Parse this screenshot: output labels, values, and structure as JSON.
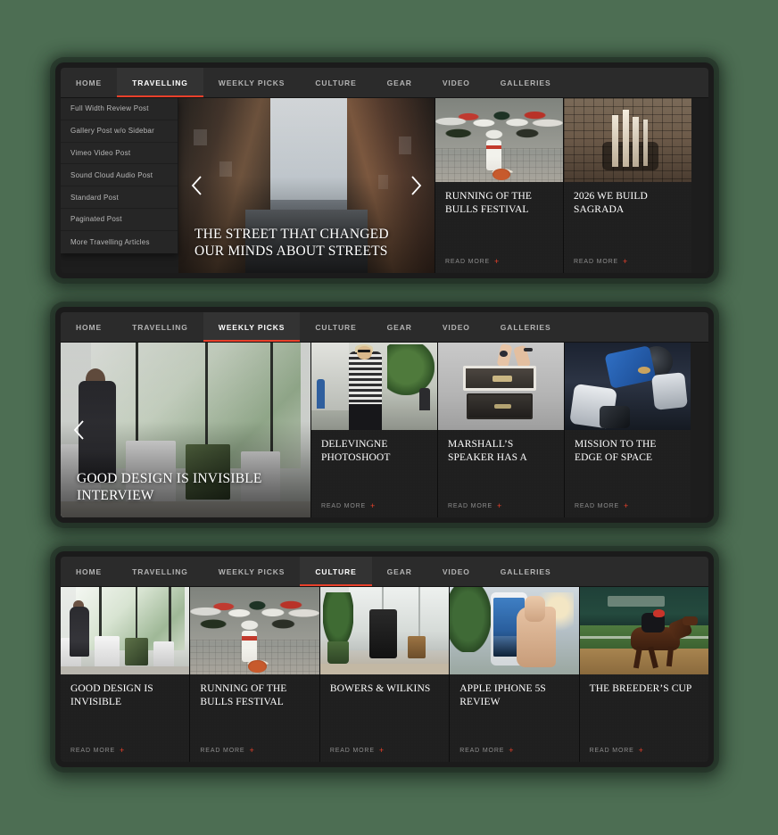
{
  "background_color": "#4d6e53",
  "accent_color": "#e8402a",
  "nav": {
    "items": [
      "HOME",
      "TRAVELLING",
      "WEEKLY PICKS",
      "CULTURE",
      "GEAR",
      "VIDEO",
      "GALLERIES"
    ]
  },
  "panels": [
    {
      "id": "panel-travelling",
      "active_tab": "TRAVELLING",
      "active_index": 1,
      "dropdown": {
        "visible": true,
        "items": [
          "Full Width Review Post",
          "Gallery Post w/o Sidebar",
          "Vimeo Video Post",
          "Sound Cloud Audio Post",
          "Standard Post",
          "Paginated Post",
          "More Travelling Articles"
        ]
      },
      "hero": {
        "title": "THE STREET THAT CHANGED OUR MINDS ABOUT STREETS",
        "photo": "street-canyon-photo",
        "prev_icon": "chevron-left-icon",
        "next_icon": "chevron-right-icon"
      },
      "cards": [
        {
          "title": "RUNNING OF THE BULLS FESTIVAL",
          "read_more": "READ MORE",
          "photo": "bull-run-crowd-photo"
        },
        {
          "title": "2026 WE BUILD SAGRADA",
          "read_more": "READ MORE",
          "photo": "sagrada-familia-aerial-photo"
        }
      ]
    },
    {
      "id": "panel-weekly-picks",
      "active_tab": "WEEKLY PICKS",
      "active_index": 2,
      "dropdown": {
        "visible": false,
        "items": []
      },
      "hero": {
        "title": "GOOD DESIGN IS INVISIBLE INTERVIEW",
        "photo": "office-imac-workspace-photo",
        "prev_icon": "chevron-left-icon",
        "next_icon": "chevron-right-icon"
      },
      "cards": [
        {
          "title": "DELEVINGNE PHOTOSHOOT",
          "read_more": "READ MORE",
          "photo": "street-style-fashion-photo"
        },
        {
          "title": "MARSHALL’S SPEAKER HAS A",
          "read_more": "READ MORE",
          "photo": "marshall-speakers-photo"
        },
        {
          "title": "MISSION TO THE EDGE OF SPACE",
          "read_more": "READ MORE",
          "photo": "spacesuit-machinery-photo"
        }
      ]
    },
    {
      "id": "panel-culture",
      "active_tab": "CULTURE",
      "active_index": 3,
      "dropdown": {
        "visible": false,
        "items": []
      },
      "hero": null,
      "cards": [
        {
          "title": "GOOD DESIGN IS INVISIBLE",
          "read_more": "READ MORE",
          "photo": "office-imac-workspace-photo"
        },
        {
          "title": "RUNNING OF THE BULLS FESTIVAL",
          "read_more": "READ MORE",
          "photo": "bull-run-crowd-photo"
        },
        {
          "title": "BOWERS & WILKINS",
          "read_more": "READ MORE",
          "photo": "bowers-wilkins-speaker-photo"
        },
        {
          "title": "APPLE IPHONE 5S REVIEW",
          "read_more": "READ MORE",
          "photo": "iphone-in-hand-photo"
        },
        {
          "title": "THE BREEDER’S CUP",
          "read_more": "READ MORE",
          "photo": "horse-racing-photo"
        }
      ]
    }
  ]
}
